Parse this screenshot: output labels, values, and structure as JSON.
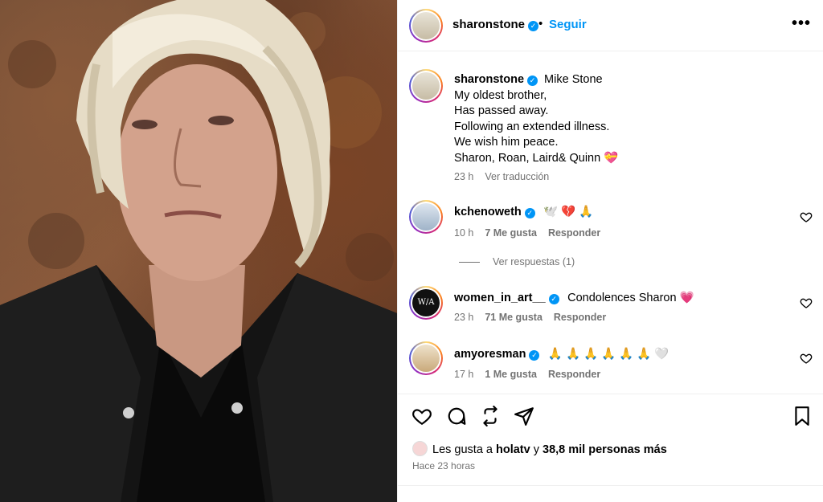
{
  "post": {
    "author": "sharonstone",
    "follow_label": "Seguir",
    "separator": "•",
    "more_label": "•••"
  },
  "caption": {
    "user": "sharonstone",
    "lines": [
      "Mike Stone",
      "My oldest brother,",
      "Has passed away.",
      "Following an extended illness.",
      "We wish him peace.",
      "Sharon, Roan, Laird& Quinn 💝"
    ],
    "time": "23 h",
    "translate_label": "Ver traducción"
  },
  "comments": [
    {
      "user": "kchenoweth",
      "text": "🕊️ 💔 🙏",
      "time": "10 h",
      "likes": "7 Me gusta",
      "reply": "Responder",
      "view_replies": "Ver respuestas (1)"
    },
    {
      "user": "women_in_art__",
      "text": "Condolences Sharon 💗",
      "time": "23 h",
      "likes": "71 Me gusta",
      "reply": "Responder",
      "avatar_text": "W/A"
    },
    {
      "user": "amyoresman",
      "text": "🙏 🙏 🙏 🙏 🙏 🙏 🤍",
      "time": "17 h",
      "likes": "1 Me gusta",
      "reply": "Responder"
    }
  ],
  "actions": {
    "icons": [
      "heart-icon",
      "comment-icon",
      "share-icon",
      "send-icon",
      "bookmark-icon"
    ]
  },
  "likes_summary": {
    "prefix": "Les gusta a ",
    "user": "holatv",
    "middle": " y ",
    "count": "38,8 mil personas más",
    "time_ago": "Hace 23 horas"
  },
  "colors": {
    "accent": "#0095f6",
    "muted": "#737373",
    "border": "#efefef"
  }
}
